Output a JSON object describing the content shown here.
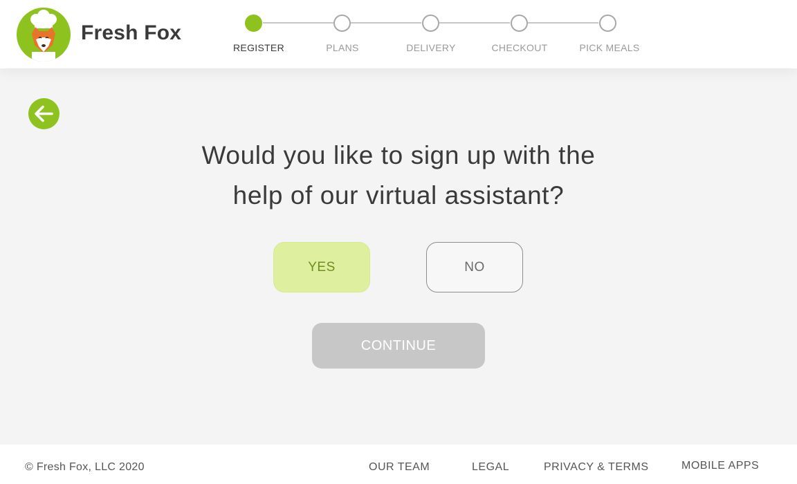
{
  "brand": {
    "name": "Fresh Fox",
    "logo_icon": "fox-chef-logo-icon",
    "accent_color": "#8ec21f"
  },
  "stepper": {
    "steps": [
      {
        "label": "REGISTER",
        "state": "active"
      },
      {
        "label": "PLANS",
        "state": "pending"
      },
      {
        "label": "DELIVERY",
        "state": "pending"
      },
      {
        "label": "CHECKOUT",
        "state": "pending"
      },
      {
        "label": "PICK MEALS",
        "state": "pending"
      }
    ]
  },
  "main": {
    "back_icon": "arrow-left-icon",
    "question_line1": "Would you like to sign up with the",
    "question_line2": "help of our virtual assistant?",
    "yes_label": "YES",
    "no_label": "NO",
    "selected": "YES",
    "continue_label": "CONTINUE",
    "continue_enabled": false
  },
  "footer": {
    "copyright": "© Fresh Fox, LLC 2020",
    "links": [
      "OUR TEAM",
      "LEGAL",
      "PRIVACY & TERMS",
      "MOBILE APPS"
    ]
  }
}
